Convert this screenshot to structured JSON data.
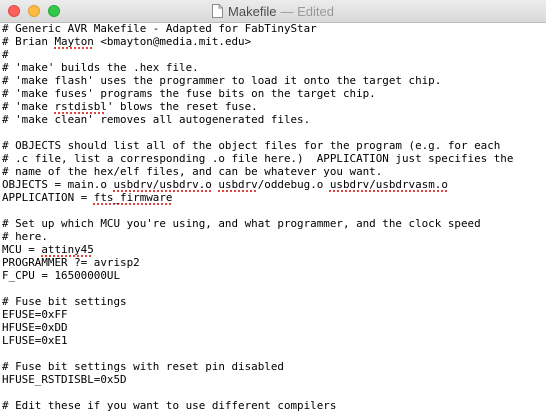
{
  "window": {
    "title": "Makefile",
    "status": "— Edited"
  },
  "editor": {
    "lines": [
      [
        "# Generic AVR Makefile - Adapted for FabTinyStar"
      ],
      [
        "# Brian ",
        {
          "s": "Mayton"
        },
        " <bmayton@media.mit.edu>"
      ],
      [
        "#"
      ],
      [
        "# 'make' builds the .hex file."
      ],
      [
        "# 'make flash' uses the programmer to load it onto the target chip."
      ],
      [
        "# 'make fuses' programs the fuse bits on the target chip."
      ],
      [
        "# 'make ",
        {
          "s": "rstdisbl"
        },
        "' blows the reset fuse."
      ],
      [
        "# 'make clean' removes all autogenerated files."
      ],
      [
        ""
      ],
      [
        "# OBJECTS should list all of the object files for the program (e.g. for each"
      ],
      [
        "# .c file, list a corresponding .o file here.)  APPLICATION just specifies the"
      ],
      [
        "# name of the hex/elf files, and can be whatever you want."
      ],
      [
        "OBJECTS = main.o ",
        {
          "s": "usbdrv/usbdrv.o"
        },
        " ",
        {
          "s": "usbdrv"
        },
        "/oddebug.o ",
        {
          "s": "usbdrv/usbdrvasm.o"
        }
      ],
      [
        "APPLICATION = ",
        {
          "s": "fts_firmware"
        }
      ],
      [
        ""
      ],
      [
        "# Set up which MCU you're using, and what programmer, and the clock speed"
      ],
      [
        "# here."
      ],
      [
        "MCU = ",
        {
          "s": "attiny45"
        }
      ],
      [
        "PROGRAMMER ?= avrisp2"
      ],
      [
        "F_CPU = 16500000UL"
      ],
      [
        ""
      ],
      [
        "# Fuse bit settings"
      ],
      [
        "EFUSE=0xFF"
      ],
      [
        "HFUSE=0xDD"
      ],
      [
        "LFUSE=0xE1"
      ],
      [
        ""
      ],
      [
        "# Fuse bit settings with reset pin disabled"
      ],
      [
        "HFUSE_RSTDISBL=0x5D"
      ],
      [
        ""
      ],
      [
        "# Edit these if you want to use different compilers"
      ]
    ]
  }
}
